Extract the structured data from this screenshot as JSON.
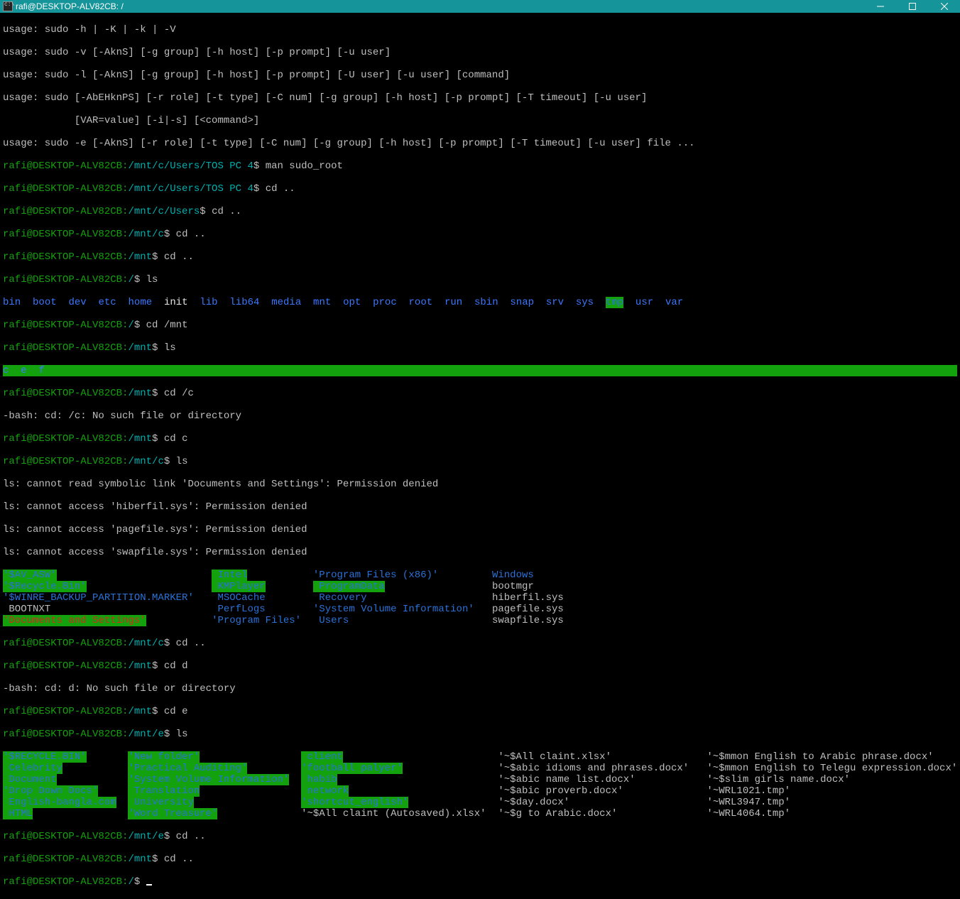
{
  "title": "rafi@DESKTOP-ALV82CB: /",
  "user_host": "rafi@DESKTOP-ALV82CB",
  "sudo_usage": {
    "l1": "usage: sudo -h | -K | -k | -V",
    "l2": "usage: sudo -v [-AknS] [-g group] [-h host] [-p prompt] [-u user]",
    "l3": "usage: sudo -l [-AknS] [-g group] [-h host] [-p prompt] [-U user] [-u user] [command]",
    "l4": "usage: sudo [-AbEHknPS] [-r role] [-t type] [-C num] [-g group] [-h host] [-p prompt] [-T timeout] [-u user]",
    "l4b": "            [VAR=value] [-i|-s] [<command>]",
    "l5": "usage: sudo -e [-AknS] [-r role] [-t type] [-C num] [-g group] [-h host] [-p prompt] [-T timeout] [-u user] file ..."
  },
  "paths": {
    "tos": "/mnt/c/Users/TOS PC 4",
    "users": "/mnt/c/Users",
    "mntc": "/mnt/c",
    "mnt": "/mnt",
    "mnte": "/mnt/e",
    "root": "/"
  },
  "cmds": {
    "man": "man sudo_root",
    "cdup": "cd ..",
    "ls": "ls",
    "cdmnt": "cd /mnt",
    "cdc_slash": "cd /c",
    "cdc": "cd c",
    "cdd": "cd d",
    "cde": "cd e"
  },
  "errs": {
    "noc": "-bash: cd: /c: No such file or directory",
    "nod": "-bash: cd: d: No such file or directory",
    "link": "ls: cannot read symbolic link 'Documents and Settings': Permission denied",
    "hib": "ls: cannot access 'hiberfil.sys': Permission denied",
    "page": "ls: cannot access 'pagefile.sys': Permission denied",
    "swap": "ls: cannot access 'swapfile.sys': Permission denied"
  },
  "root_dirs": [
    "bin",
    "boot",
    "dev",
    "etc",
    "home",
    "init",
    "lib",
    "lib64",
    "media",
    "mnt",
    "opt",
    "proc",
    "root",
    "run",
    "sbin",
    "snap",
    "srv",
    "sys",
    "tmp",
    "usr",
    "var"
  ],
  "mnt_items": [
    "c",
    "e",
    "f"
  ],
  "c_col1": [
    "'$AV_ASW'",
    "'$Recycle.Bin'",
    "'$WINRE_BACKUP_PARTITION.MARKER'",
    " BOOTNXT",
    "'Documents and Settings'"
  ],
  "c_col2": [
    " Intel",
    " KMPlayer",
    " MSOCache",
    " PerfLogs",
    "'Program Files'"
  ],
  "c_col3": [
    "'Program Files (x86)'",
    " ProgramData",
    " Recovery",
    "'System Volume Information'",
    " Users"
  ],
  "c_col4": [
    " Windows",
    " bootmgr",
    " hiberfil.sys",
    " pagefile.sys",
    " swapfile.sys"
  ],
  "e_col1": [
    "'$RECYCLE.BIN'",
    " Celebrity",
    " Document",
    "'Drop Down Docs'",
    " English-bangla.com",
    " HTML"
  ],
  "e_col2": [
    "'New folder'",
    "'Practical Auditing'",
    "'System Volume Information'",
    " Translation",
    " University",
    "'Word Treasure'"
  ],
  "e_col3": [
    " client",
    "'football palyer'",
    " habib",
    " network",
    "'shortcut_english'",
    "'~$All claint (Autosaved).xlsx'"
  ],
  "e_col4": [
    "'~$All claint.xlsx'",
    "'~$abic idioms and phrases.docx'",
    "'~$abic name list.docx'",
    "'~$abic proverb.docx'",
    "'~$day.docx'",
    "'~$g to Arabic.docx'"
  ],
  "e_col5": [
    "'~$mmon English to Arabic phrase.docx'",
    "'~$mmon English to Telegu expression.docx'",
    "'~$slim girls name.docx'",
    "'~WRL1021.tmp'",
    "'~WRL3947.tmp'",
    "'~WRL4064.tmp'"
  ]
}
